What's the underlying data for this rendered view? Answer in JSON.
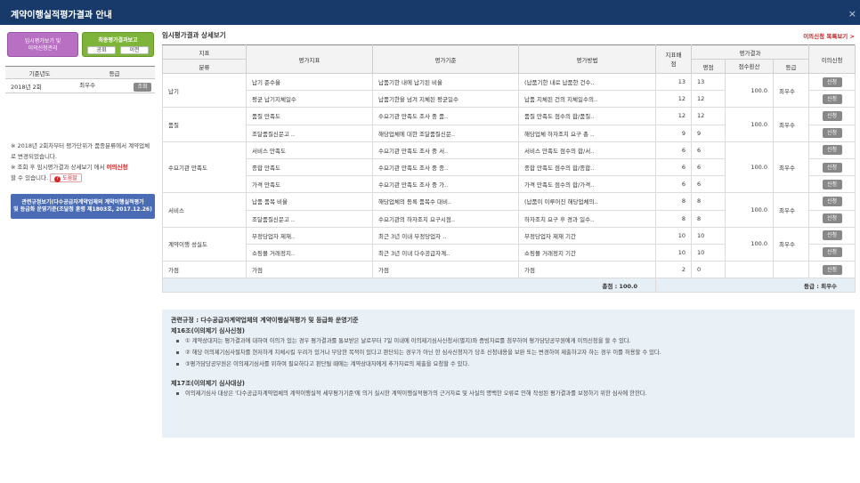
{
  "window": {
    "title": "계약이행실적평가결과 안내",
    "close": "×"
  },
  "left": {
    "interim_button": [
      "임시평가보기 및",
      "이의신청관리"
    ],
    "final_report": {
      "title": "최종평가결과보고",
      "btn_public": "공회",
      "btn_prev": "이전"
    },
    "year_table": {
      "headers": [
        "기준년도",
        "등급"
      ],
      "row": {
        "year": "2018년 2회",
        "grade": "최우수",
        "button": "조회"
      }
    },
    "notes": {
      "line1": "※ 2018년 2회차부터 평가단위가 품종분류에서 계약업체로 변경되었습니다.",
      "line2_a": "※ 조회 후 임시평가결과 상세보기 에서 ",
      "line2_red": "이의신청",
      "line2_b": "할 수 있습니다.",
      "help": "도움말"
    },
    "regulation_button": [
      "관련규정보기(다수공급자계약업체의 계약이행실적평가",
      "및 등급화 운영기준(조달청 훈령 제1803호, 2017.12.26)"
    ]
  },
  "right": {
    "section_title": "임시평가결과 상세보기",
    "objection_link": "이의신청 목록보기 >",
    "headers": {
      "indicator": "지표",
      "category": "분류",
      "eval_indicator": "평가지표",
      "eval_standard": "평가기준",
      "eval_method": "평가방법",
      "weight": "지표배점",
      "result": "평가결과",
      "score": "평점",
      "converted": "점수환산",
      "grade": "등급",
      "objection": "이의신청"
    },
    "rows": [
      {
        "category": "납기",
        "indicator": "납기 준수율",
        "standard": "납품기한 내에 납기된 비율",
        "method": "(납품기한 내로 납품한 건수..",
        "weight": "13",
        "score": "13",
        "converted": "100.0",
        "grade": "최우수",
        "button": "신청"
      },
      {
        "indicator": "평균 납기지체일수",
        "standard": "납품기한을 넘겨 지체된 평균일수",
        "method": "납품 지체된 건의 지체일수의..",
        "weight": "12",
        "score": "12",
        "button": "신청"
      },
      {
        "category": "품질",
        "indicator": "품질 만족도",
        "standard": "수요기관 만족도 조사 중 품..",
        "method": "품질 만족도 점수의 합/품질..",
        "weight": "12",
        "score": "12",
        "converted": "100.0",
        "grade": "최우수",
        "button": "신청"
      },
      {
        "indicator": "조달품질신문고 ..",
        "standard": "해당업체에 대한 조달품질신문..",
        "method": "해당업체 하자조치 요구 총 ..",
        "weight": "9",
        "score": "9",
        "button": "신청"
      },
      {
        "category": "수요기관 만족도",
        "indicator": "서비스 만족도",
        "standard": "수요기관 만족도 조사 중 서..",
        "method": "서비스 만족도 점수의 합/서..",
        "weight": "6",
        "score": "6",
        "converted": "100.0",
        "grade": "최우수",
        "button": "신청"
      },
      {
        "indicator": "종합 만족도",
        "standard": "수요기관 만족도 조사 중 종..",
        "method": "종합 만족도 점수의 합/종합..",
        "weight": "6",
        "score": "6",
        "button": "신청"
      },
      {
        "indicator": "가격 만족도",
        "standard": "수요기관 만족도 조사 중 가..",
        "method": "가격 만족도 점수의 합/가격..",
        "weight": "6",
        "score": "6",
        "button": "신청"
      },
      {
        "category": "서비스",
        "indicator": "납품 품목 비율",
        "standard": "해당업체의 등록 품목수 대비..",
        "method": "(납품이 이루어진 해당업체의..",
        "weight": "8",
        "score": "8",
        "converted": "100.0",
        "grade": "최우수",
        "button": "신청"
      },
      {
        "indicator": "조달품질신문고 ..",
        "standard": "수요기관의 하자조치 요구시점..",
        "method": "하자조치 요구 후 경과 일수..",
        "weight": "8",
        "score": "8",
        "button": "신청"
      },
      {
        "category": "계약이행 성실도",
        "indicator": "부정당업자 제재..",
        "standard": "최근 3년 이내 부정당업자 ..",
        "method": "부정당업자 제재 기간",
        "weight": "10",
        "score": "10",
        "converted": "100.0",
        "grade": "최우수",
        "button": "신청"
      },
      {
        "indicator": "쇼핑몰 거래정지..",
        "standard": "최근 3년 이내 다수공급자계..",
        "method": "쇼핑몰 거래정지 기간",
        "weight": "10",
        "score": "10",
        "button": "신청"
      },
      {
        "category": "가점",
        "indicator": "가점",
        "standard": "가점",
        "method": "가점",
        "weight": "2",
        "score": "0",
        "converted": "",
        "grade": "",
        "button": "신청"
      }
    ],
    "total": {
      "score": "총점 : 100.0",
      "grade": "등급 : 최우수"
    },
    "rules": {
      "title": "관련규정 : 다수공급자계약업체의 계약이행실적평가 및 등급화 운영기준",
      "art16": "제16조(이의제기 심사신청)",
      "art16_items": [
        "① 계약상대자는 평가결과에 대하여 이의가 있는 경우 평가결과를 통보받은 날로부터 7일 이내에 이의제기심사신청서(별지)와 증빙자료를 첨부하여 평가담당공무원에게 이의신청을 할 수 있다.",
        "② 해당 이의제기심사절차를 현저하게 지체시킬 우려가 있거나 부당한 목적이 있다고 판단되는 경우가 아닌 한 심사신청자가 당초 신청내용을 보완 또는 변경하여 제출하고자 하는 경우 이를 허용할 수 있다.",
        "③평가담당공무원은 이의제기심사를 위하여 필요하다고 판단될 때에는 계약상대자에게 추가자료의 제출을 요청할 수 있다."
      ],
      "art17": "제17조(이의제기 심사대상)",
      "art17_items": [
        "이의제기심사 대상은 '다수공급자계약업체의 계약이행실적 세부평가기준'에 의거 실시한 계약이행실적평가의 근거자료 및 사실의 명백한 오류로 인해 작성된 평가결과를 보정하기 위한 심사에 한한다."
      ]
    }
  }
}
